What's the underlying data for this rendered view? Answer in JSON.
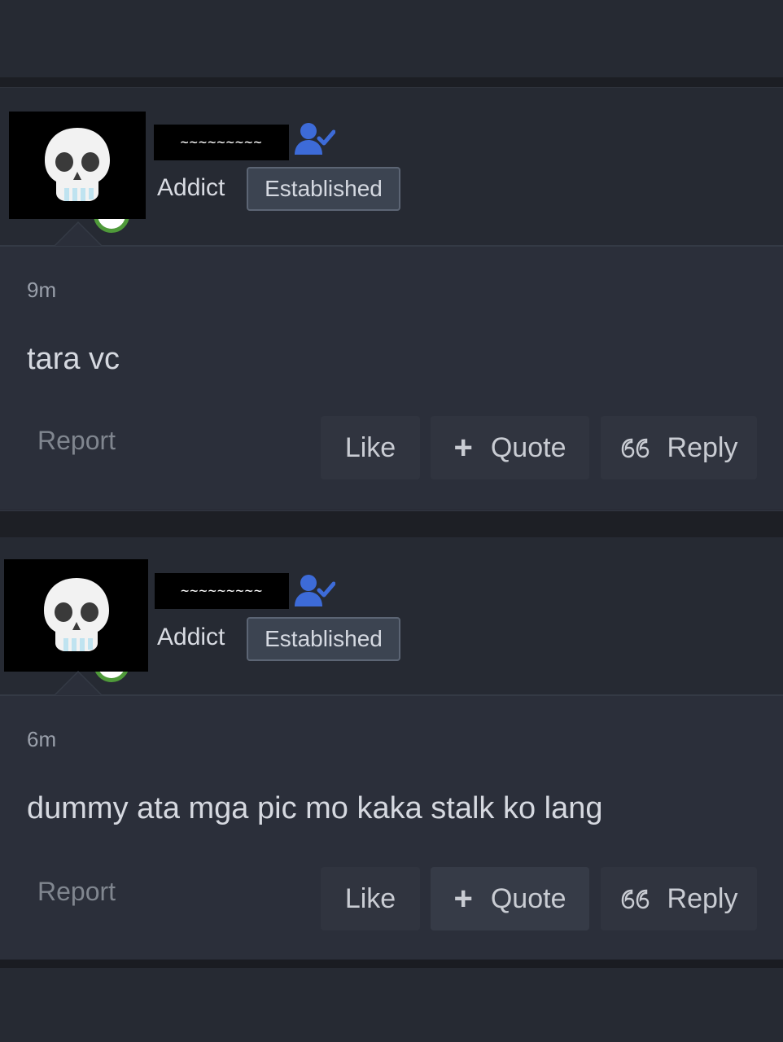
{
  "posts": [
    {
      "username": "~~~~~~~~~",
      "role": "Addict",
      "badge": "Established",
      "time": "9m",
      "message": "tara vc",
      "report_label": "Report",
      "actions": {
        "like": "Like",
        "quote": "Quote",
        "reply": "Reply"
      }
    },
    {
      "username": "~~~~~~~~~",
      "role": "Addict",
      "badge": "Established",
      "time": "6m",
      "message": "dummy ata mga pic mo kaka stalk ko lang",
      "report_label": "Report",
      "actions": {
        "like": "Like",
        "quote": "Quote",
        "reply": "Reply"
      }
    }
  ],
  "icons": {
    "avatar": "skull-emoji-avatar",
    "verified": "user-check-icon",
    "quote": "plus-icon",
    "reply": "quote-marks-icon"
  },
  "colors": {
    "background": "#252831",
    "post_body": "#2b2f3a",
    "verified_icon": "#3d6bd8",
    "online_ring": "#4f9a3a"
  }
}
